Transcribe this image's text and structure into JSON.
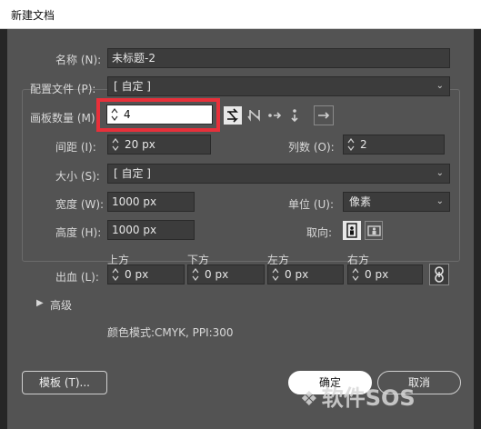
{
  "window": {
    "title": "新建文档"
  },
  "fields": {
    "name": {
      "label": "名称 (N):",
      "value": "未标题-2"
    },
    "profile": {
      "label": "配置文件 (P):",
      "value": "[ 自定 ]"
    },
    "artboards": {
      "label": "画板数量 (M)",
      "value": "4"
    },
    "spacing": {
      "label": "间距 (I):",
      "value": "20 px"
    },
    "columns": {
      "label": "列数 (O):",
      "value": "2"
    },
    "size": {
      "label": "大小 (S):",
      "value": "[ 自定 ]"
    },
    "width": {
      "label": "宽度 (W):",
      "value": "1000 px"
    },
    "units": {
      "label": "单位 (U):",
      "value": "像素"
    },
    "height": {
      "label": "高度 (H):",
      "value": "1000 px"
    },
    "orientation": {
      "label": "取向:"
    }
  },
  "bleed": {
    "label": "出血 (L):",
    "top": {
      "label": "上方",
      "value": "0 px"
    },
    "bottom": {
      "label": "下方",
      "value": "0 px"
    },
    "left": {
      "label": "左方",
      "value": "0 px"
    },
    "right": {
      "label": "右方",
      "value": "0 px"
    }
  },
  "advanced": {
    "label": "高级"
  },
  "color_mode_text": "颜色模式:CMYK, PPI:300",
  "buttons": {
    "templates": "模板 (T)...",
    "ok": "确定",
    "cancel": "取消"
  },
  "watermark": "软件SOS",
  "colors": {
    "highlight": "#e8303a",
    "dialog_bg": "#535353",
    "field_bg": "#3c3c3c"
  }
}
